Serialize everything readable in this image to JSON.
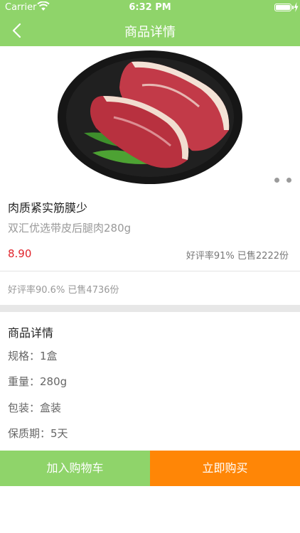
{
  "status_bar": {
    "carrier": "Carrier",
    "time": "6:32 PM"
  },
  "nav": {
    "title": "商品详情",
    "back_icon": "chevron-left-icon"
  },
  "product": {
    "title": "肉质紧实筋膜少",
    "subtitle": "双汇优选带皮后腿肉280g",
    "price": "8.90",
    "stats_right": "好评率91%  已售2222份",
    "stats_left": "好评率90.6%   已售4736份"
  },
  "details": {
    "title": "商品详情",
    "spec": "规格：1盒",
    "weight": "重量：280g",
    "package": "包装：盒装",
    "shelf_life": "保质期：5天"
  },
  "actions": {
    "add_to_cart": "加入购物车",
    "buy_now": "立即购买"
  },
  "colors": {
    "green": "#8fd46a",
    "orange": "#ff8606",
    "price_red": "#e0232b"
  }
}
